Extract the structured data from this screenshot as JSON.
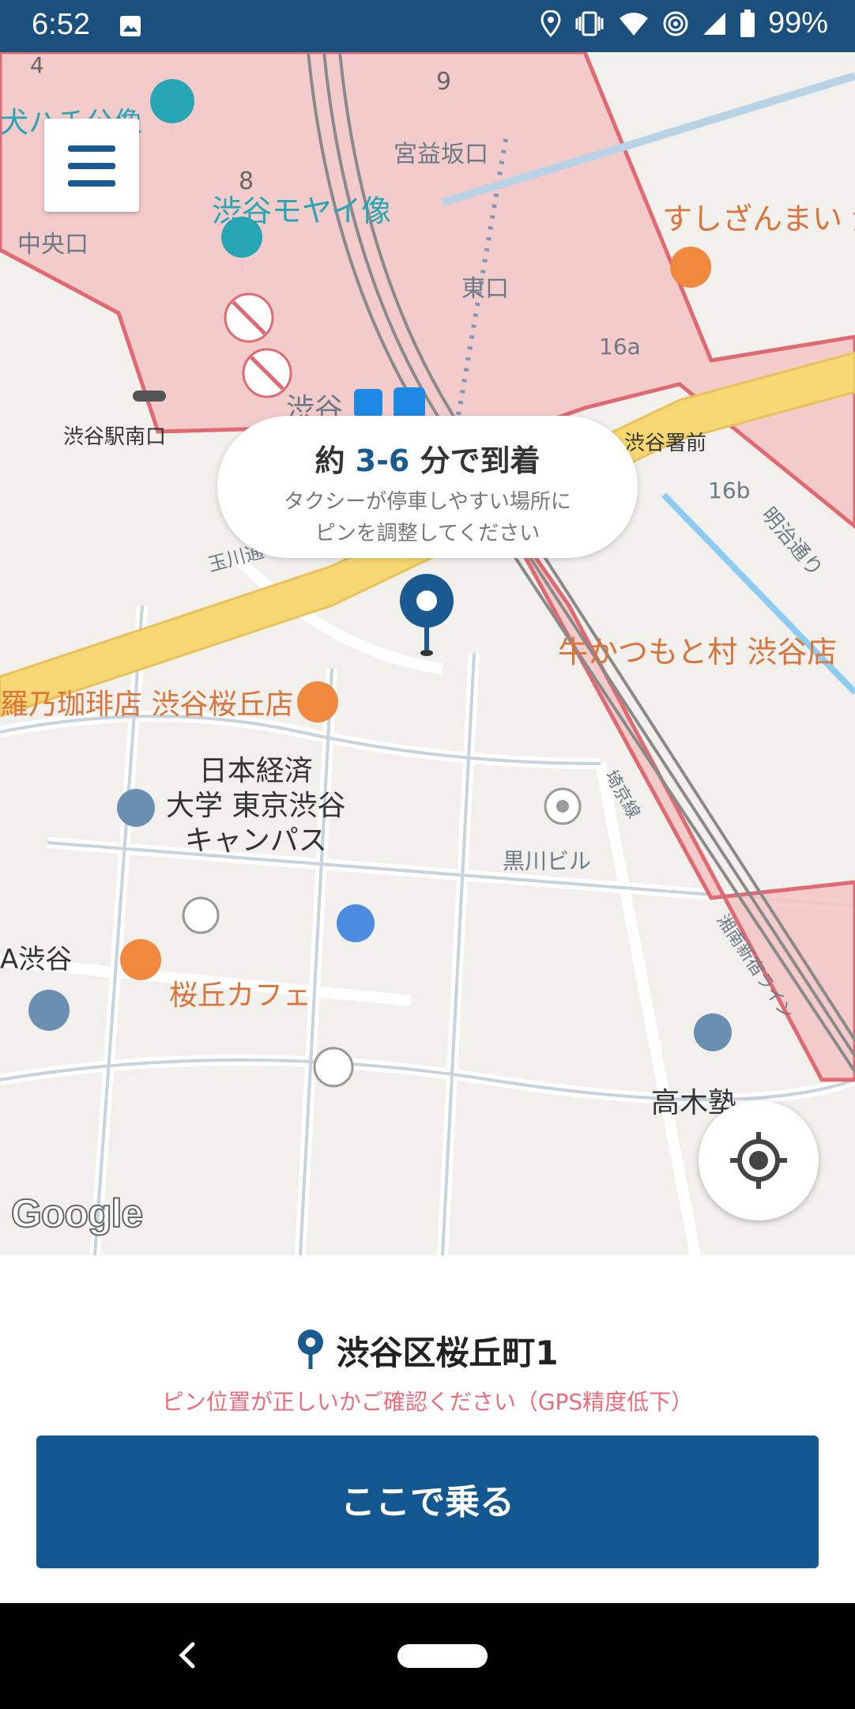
{
  "status_bar": {
    "time": "6:52",
    "battery": "99%",
    "icons": [
      "image-icon",
      "location-icon",
      "vibrate-icon",
      "wifi-icon",
      "hotspot-icon",
      "signal-icon",
      "battery-icon"
    ]
  },
  "map": {
    "labels": {
      "hachiko": "犬ハチ公像",
      "moyai": "渋谷モヤイ像",
      "miyamasuzaka": "宮益坂口",
      "chuo": "中央口",
      "higashi": "東口",
      "minami": "渋谷駅南口",
      "shibuya": "渋谷",
      "sushi": "すしざんまい 渋",
      "keisatsu": "渋谷署前",
      "meiji": "明治通り",
      "gyukatsu": "牛かつもと村 渋谷店",
      "coffee": "羅乃珈琲店 渋谷桜丘店",
      "nikkei": "日本経済\n大学 東京渋谷\nキャンパス",
      "kurokawa": "黒川ビル",
      "shibuya_left": "A渋谷",
      "sakuragaoka_cafe": "桜丘カフェ",
      "takagi": "高木塾",
      "num4": "4",
      "num9": "9",
      "num8": "8",
      "exit16a": "16a",
      "exit16b": "16b",
      "tamagawa": "玉川通",
      "shibuya_rail": "埼京線",
      "shonan": "湘南新宿ライン"
    },
    "eta": {
      "prefix": "約 ",
      "range": "3-6",
      "suffix": " 分で到着",
      "hint_line1": "タクシーが停車しやすい場所に",
      "hint_line2": "ピンを調整してください"
    },
    "attribution": "Google",
    "colors": {
      "restricted_zone": "#f4c4c4",
      "zone_border": "#e06a72",
      "highway": "#f7d774",
      "brand": "#145891"
    }
  },
  "panel": {
    "address": "渋谷区桜丘町1",
    "warning": "ピン位置が正しいかご確認ください（GPS精度低下）",
    "ride_button": "ここで乗る"
  }
}
